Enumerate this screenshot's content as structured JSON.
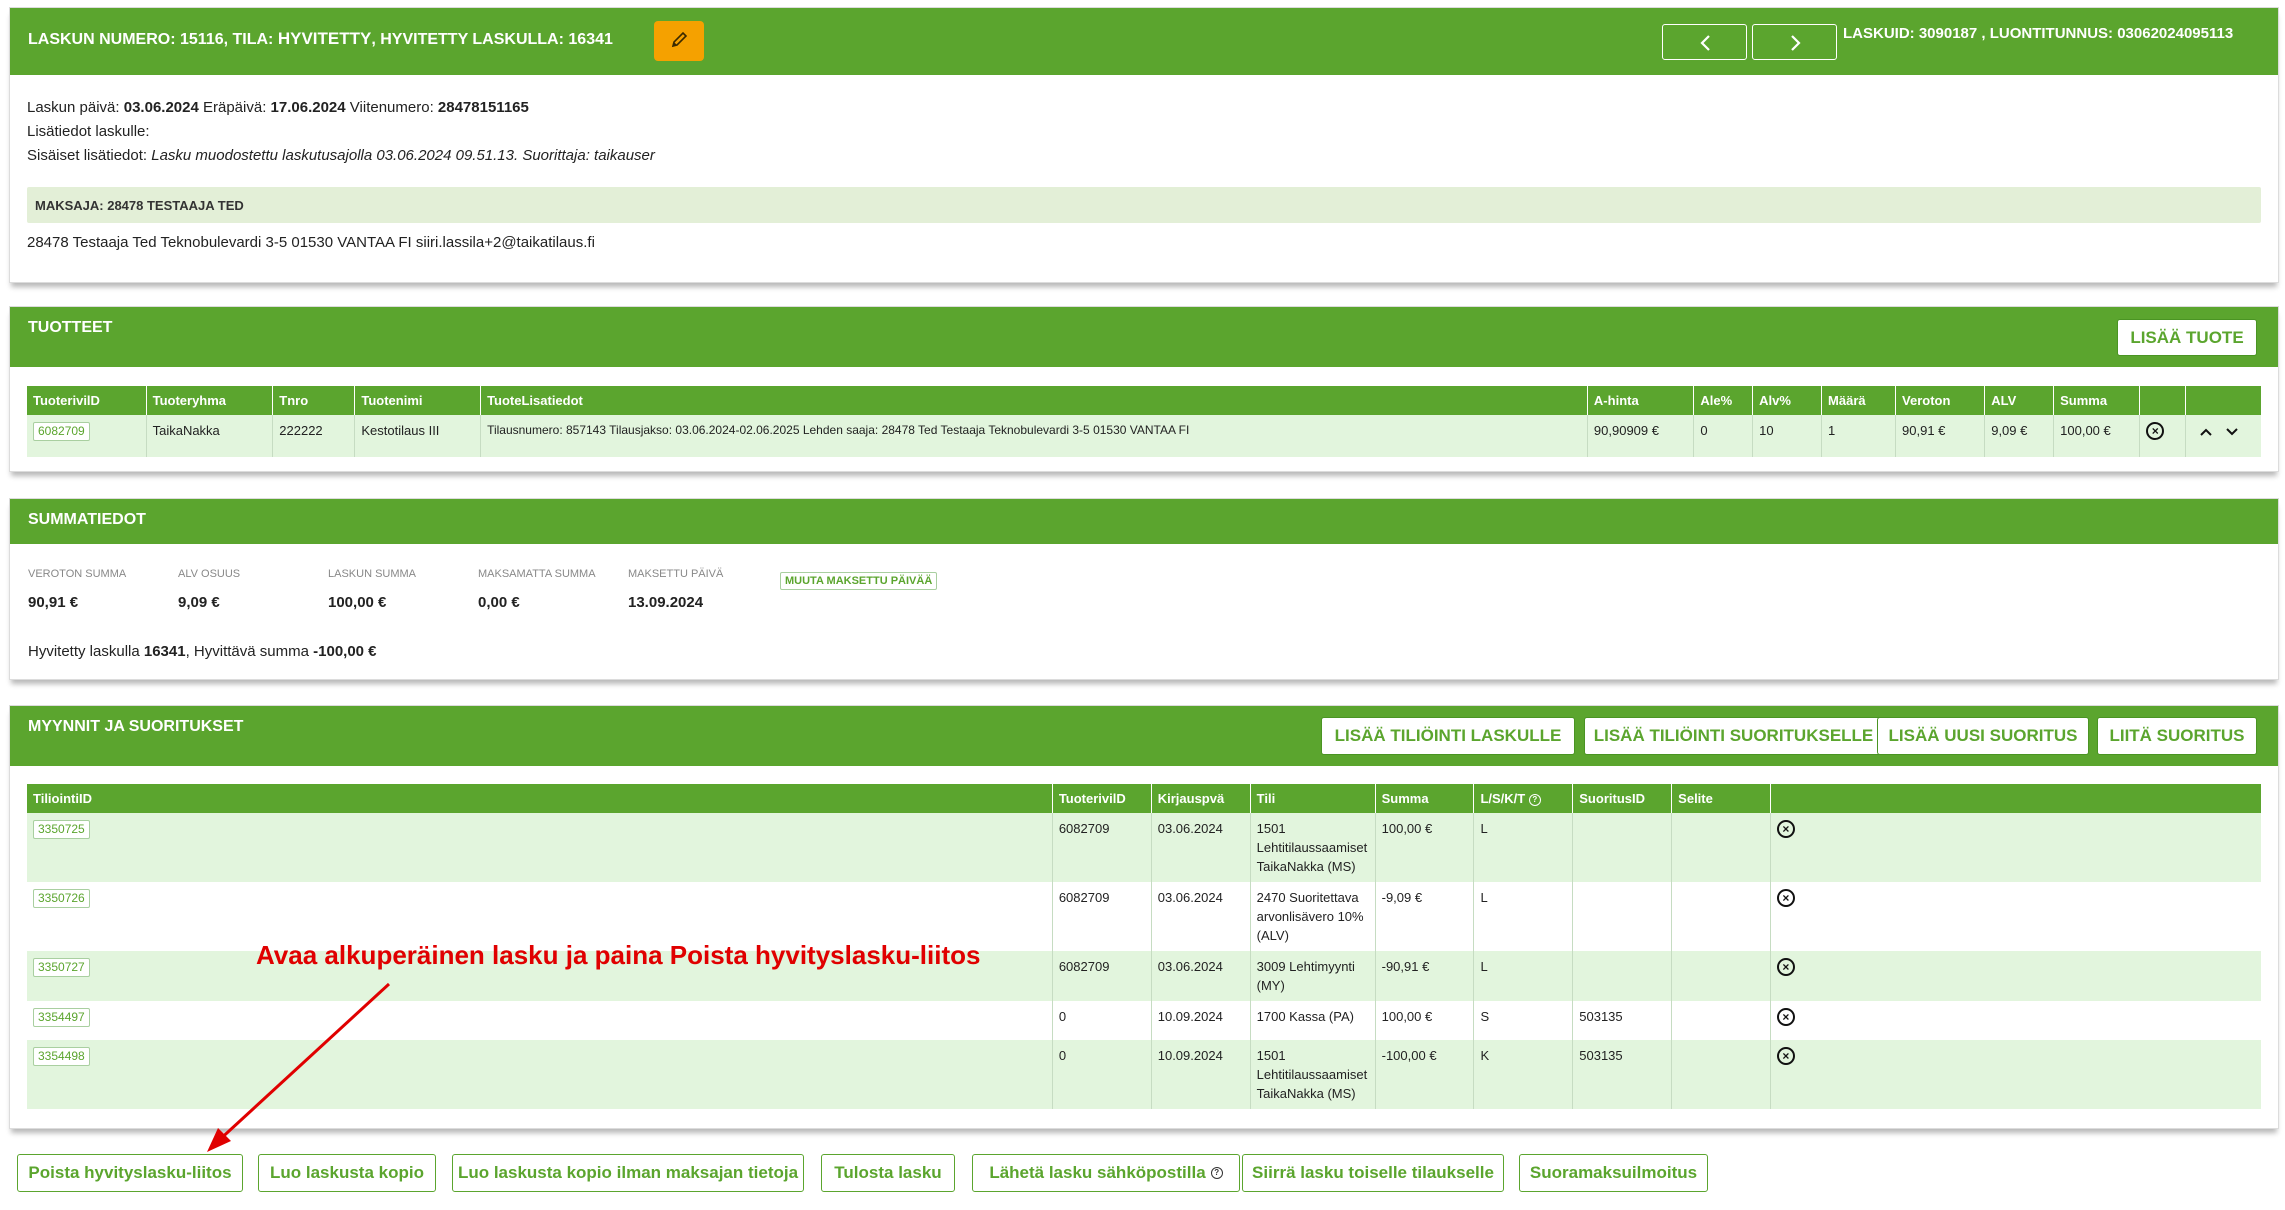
{
  "header": {
    "laskun_label": "LASKUN NUMERO:",
    "laskun_numero": "15116",
    "tila_label": ", TILA:",
    "tila_value": "HYVITETTY",
    "hyvitetty_label": ", HYVITETTY LASKULLA:",
    "hyvitetty_value": "16341",
    "right_info": "LASKUID: 3090187 , LUONTITUNNUS: 03062024095113"
  },
  "info": {
    "paiva_label": "Laskun päivä:",
    "paiva": "03.06.2024",
    "erapaiva_label": "Eräpäivä:",
    "erapaiva": "17.06.2024",
    "viite_label": "Viitenumero:",
    "viite": "28478151165",
    "lisatiedot": "Lisätiedot laskulle:",
    "sisaiset_label": "Sisäiset lisätiedot:",
    "sisaiset_value": "Lasku muodostettu laskutusajolla 03.06.2024 09.51.13. Suorittaja: taikauser",
    "maksaja": "MAKSAJA: 28478 TESTAAJA TED",
    "osoite": "28478 Testaaja Ted Teknobulevardi 3-5 01530 VANTAA FI siiri.lassila+2@taikatilaus.fi"
  },
  "tuotteet": {
    "title": "TUOTTEET",
    "add_button": "LISÄÄ TUOTE",
    "columns": [
      "TuoterivilD",
      "Tuoteryhma",
      "Tnro",
      "Tuotenimi",
      "TuoteLisatiedot",
      "A-hinta",
      "Ale%",
      "Alv%",
      "Määrä",
      "Veroton",
      "ALV",
      "Summa",
      "",
      ""
    ],
    "row": {
      "id": "6082709",
      "ryhma": "TaikaNakka",
      "tnro": "222222",
      "nimi": "Kestotilaus III",
      "lisatiedot": "Tilausnumero: 857143 Tilausjakso: 03.06.2024-02.06.2025 Lehden saaja: 28478 Ted Testaaja Teknobulevardi 3-5 01530 VANTAA FI",
      "ahinta": "90,90909 €",
      "ale": "0",
      "alv_pct": "10",
      "maara": "1",
      "veroton": "90,91 €",
      "alv": "9,09 €",
      "summa": "100,00 €"
    }
  },
  "summatiedot": {
    "title": "SUMMATIEDOT",
    "stats": [
      {
        "label": "VEROTON SUMMA",
        "value": "90,91 €"
      },
      {
        "label": "ALV OSUUS",
        "value": "9,09 €"
      },
      {
        "label": "LASKUN SUMMA",
        "value": "100,00 €"
      },
      {
        "label": "MAKSAMATTA SUMMA",
        "value": "0,00 €"
      },
      {
        "label": "MAKSETTU PÄIVÄ",
        "value": "13.09.2024"
      }
    ],
    "muuta_button": "MUUTA MAKSETTU PÄIVÄÄ",
    "hyv_label1": "Hyvitetty laskulla",
    "hyv_value1": "16341",
    "hyv_label2": ", Hyvittävä summa",
    "hyv_value2": "-100,00 €"
  },
  "myynnit": {
    "title": "MYYNNIT JA SUORITUKSET",
    "buttons": [
      "LISÄÄ TILIÖINTI LASKULLE",
      "LISÄÄ TILIÖINTI SUORITUKSELLE",
      "LISÄÄ UUSI SUORITUS",
      "LIITÄ SUORITUS"
    ],
    "columns": [
      "TiliointiID",
      "TuoterivilD",
      "Kirjauspvä",
      "Tili",
      "Summa",
      "L/S/K/T",
      "SuoritusID",
      "Selite",
      ""
    ],
    "rows": [
      {
        "id": "3350725",
        "tuoterivi": "6082709",
        "pvm": "03.06.2024",
        "tili": "1501 Lehtitilaussaamiset TaikaNakka (MS)",
        "summa": "100,00 €",
        "lskt": "L",
        "suoritus": "",
        "selite": ""
      },
      {
        "id": "3350726",
        "tuoterivi": "6082709",
        "pvm": "03.06.2024",
        "tili": "2470 Suoritettava arvonlisävero 10% (ALV)",
        "summa": "-9,09 €",
        "lskt": "L",
        "suoritus": "",
        "selite": ""
      },
      {
        "id": "3350727",
        "tuoterivi": "6082709",
        "pvm": "03.06.2024",
        "tili": "3009 Lehtimyynti (MY)",
        "summa": "-90,91 €",
        "lskt": "L",
        "suoritus": "",
        "selite": ""
      },
      {
        "id": "3354497",
        "tuoterivi": "0",
        "pvm": "10.09.2024",
        "tili": "1700 Kassa (PA)",
        "summa": "100,00 €",
        "lskt": "S",
        "suoritus": "503135",
        "selite": ""
      },
      {
        "id": "3354498",
        "tuoterivi": "0",
        "pvm": "10.09.2024",
        "tili": "1501 Lehtitilaussaamiset TaikaNakka (MS)",
        "summa": "-100,00 €",
        "lskt": "K",
        "suoritus": "503135",
        "selite": ""
      }
    ]
  },
  "annotation": "Avaa alkuperäinen lasku ja paina Poista hyvityslasku-liitos",
  "bottom_buttons": [
    "Poista hyvityslasku-liitos",
    "Luo laskusta kopio",
    "Luo laskusta kopio ilman maksajan tietoja",
    "Tulosta lasku",
    "Lähetä lasku sähköpostilla",
    "Siirrä lasku toiselle tilaukselle",
    "Suoramaksuilmoitus"
  ],
  "colors": {
    "green": "#5ba52e",
    "light_green": "#e2f5dd",
    "orange": "#f5a100",
    "annotation_red": "#e00000"
  }
}
